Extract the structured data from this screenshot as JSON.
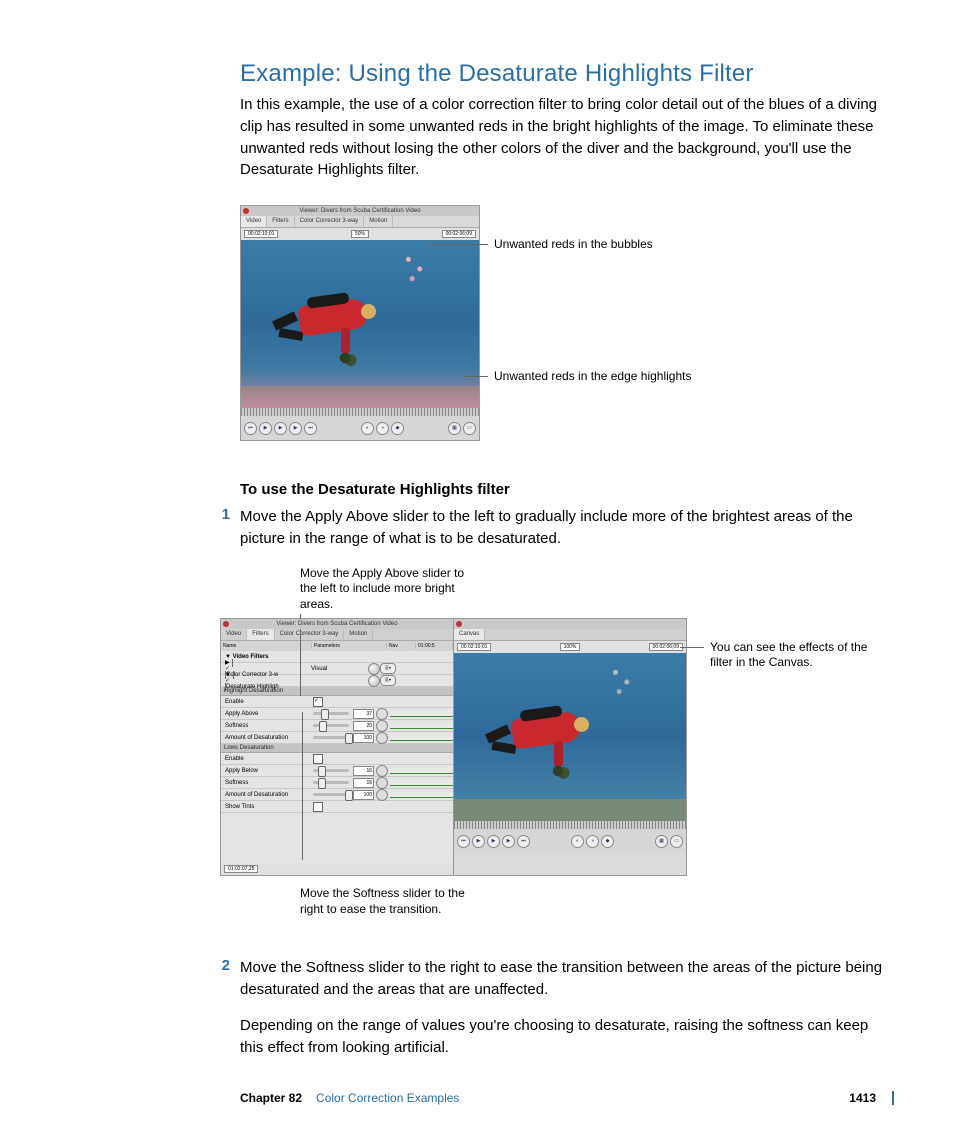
{
  "heading": "Example: Using the Desaturate Highlights Filter",
  "intro": "In this example, the use of a color correction filter to bring color detail out of the blues of a diving clip has resulted in some unwanted reds in the bright highlights of the image. To eliminate these unwanted reds without losing the other colors of the diver and the background, you'll use the Desaturate Highlights filter.",
  "viewer1": {
    "title": "Viewer: Divers from Scuba Certification Video",
    "tabs": [
      "Video",
      "Filters",
      "Color Corrector 3-way",
      "Motion"
    ],
    "tc_left": "00:02:10;01",
    "tc_pct": "50%",
    "tc_right": "00:02:06;09"
  },
  "callout1a": "Unwanted reds in the bubbles",
  "callout1b": "Unwanted reds in the edge highlights",
  "subhead": "To use the Desaturate Highlights filter",
  "step1": "Move the Apply Above slider to the left to gradually include more of the brightest areas of the picture in the range of what is to be desaturated.",
  "fig2_caption_top": "Move the Apply Above slider to the left to include more bright areas.",
  "filters": {
    "title": "Viewer: Divers from Scuba Certification Video",
    "tabs": [
      "Video",
      "Filters",
      "Color Corrector 3-way",
      "Motion"
    ],
    "hdr": [
      "Name",
      "Parameters",
      "Nav",
      "01:00:5"
    ],
    "video_filters": "Video Filters",
    "cc3": "Color Corrector 3-w",
    "dh": "Desaturate Highligh",
    "visual": "Visual",
    "section_hi": "Highlight Desaturation",
    "section_lo": "Lows Desaturation",
    "rows_hi": [
      {
        "label": "Enable",
        "checked": true
      },
      {
        "label": "Apply Above",
        "val": "37",
        "pos": 22
      },
      {
        "label": "Softness",
        "val": "20",
        "pos": 18
      },
      {
        "label": "Amount of Desaturation",
        "val": "100",
        "pos": 90
      }
    ],
    "rows_lo": [
      {
        "label": "Enable",
        "checked": false
      },
      {
        "label": "Apply Below",
        "val": "16",
        "pos": 14
      },
      {
        "label": "Softness",
        "val": "16",
        "pos": 14
      },
      {
        "label": "Amount of Desaturation",
        "val": "100",
        "pos": 90
      }
    ],
    "show_tints": "Show Tints",
    "tc": "01:02:07;25"
  },
  "canvas2": {
    "tabs": [
      "Canvas"
    ],
    "tc_left": "00:02:10;01",
    "tc_pct": "100%",
    "tc_right": "00:02:06;09"
  },
  "fig2_caption_right": "You can see the effects of the filter in the Canvas.",
  "fig2_caption_bottom": "Move the Softness slider to the right to ease the transition.",
  "step2": "Move the Softness slider to the right to ease the transition between the areas of the picture being desaturated and the areas that are unaffected.",
  "step2_extra": "Depending on the range of values you're choosing to desaturate, raising the softness can keep this effect from looking artificial.",
  "footer": {
    "chapter": "Chapter 82",
    "title": "Color Correction Examples",
    "page": "1413"
  }
}
